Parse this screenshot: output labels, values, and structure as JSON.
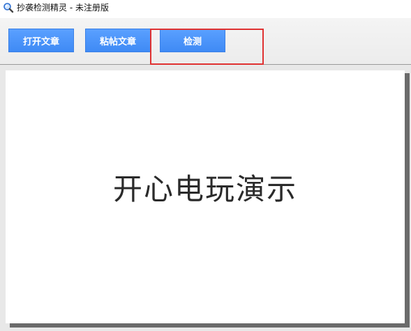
{
  "window": {
    "title": "抄袭检测精灵 - 未注册版",
    "icon": "magnifier-icon"
  },
  "toolbar": {
    "buttons": [
      {
        "label": "打开文章"
      },
      {
        "label": "粘帖文章"
      },
      {
        "label": "检测"
      }
    ],
    "highlight_color": "#e03232",
    "button_color": "#4a90f7"
  },
  "document": {
    "text": "开心电玩演示"
  }
}
